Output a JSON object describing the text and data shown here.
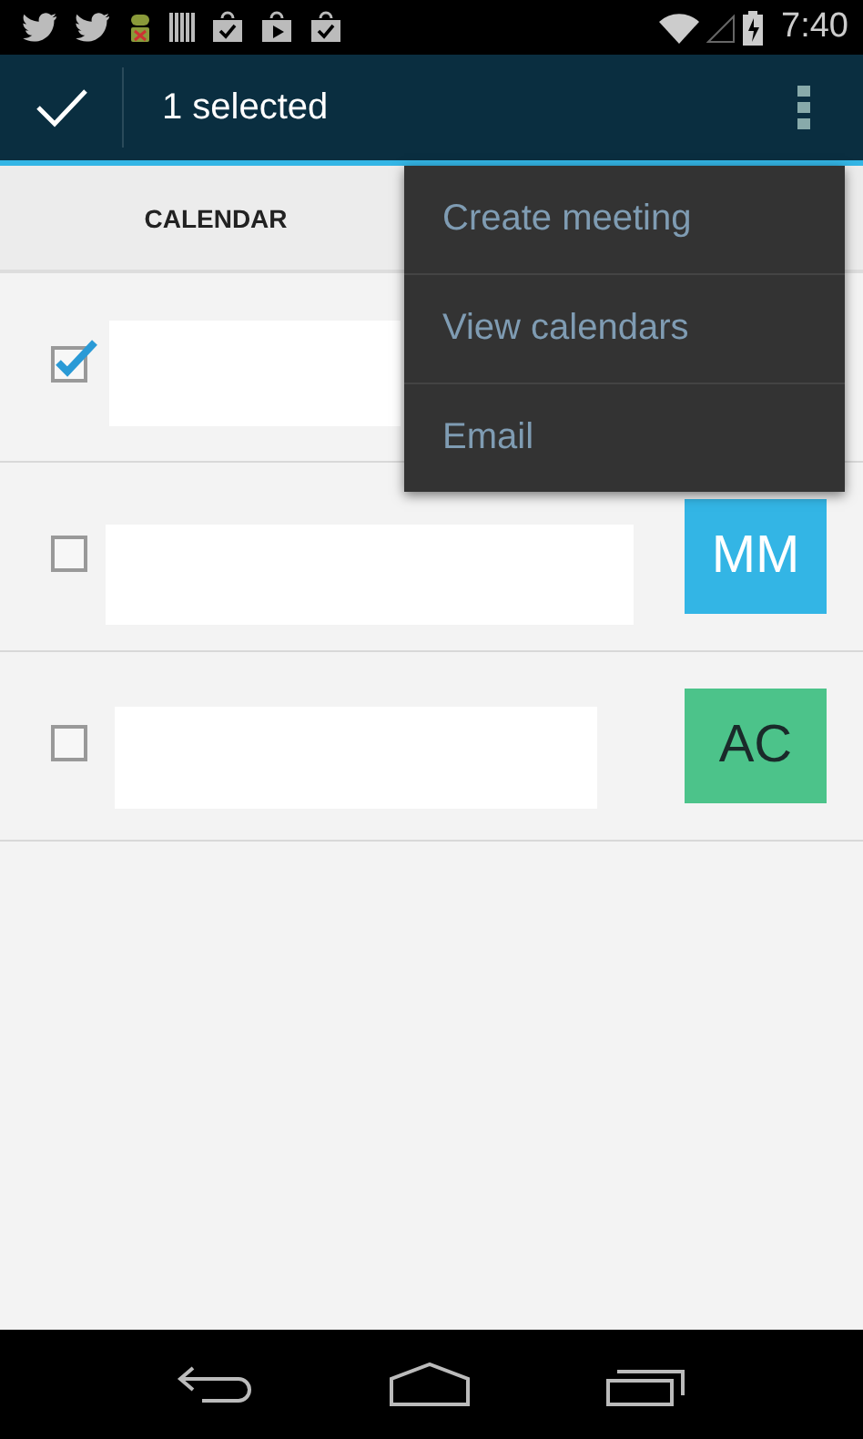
{
  "status_bar": {
    "time": "7:40"
  },
  "action_bar": {
    "title": "1 selected"
  },
  "tabs": [
    {
      "label": "CALENDAR"
    }
  ],
  "menu": {
    "items": [
      "Create meeting",
      "View calendars",
      "Email"
    ]
  },
  "contacts": [
    {
      "checked": true
    },
    {
      "checked": false,
      "initials": "MM",
      "color": "#33b5e5"
    },
    {
      "checked": false,
      "initials": "AC",
      "color": "#4cc38a"
    }
  ]
}
